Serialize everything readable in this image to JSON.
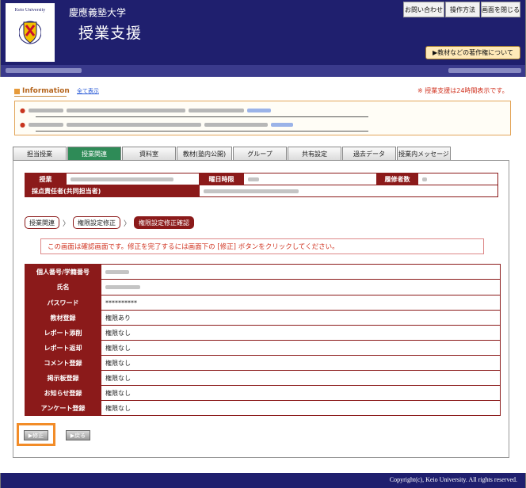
{
  "header": {
    "logo_text": "Keio University",
    "university_name": "慶應義塾大学",
    "site_title": "授業支援",
    "buttons": {
      "contact": "お問い合わせ",
      "manual": "操作方法",
      "close": "画面を閉じる"
    },
    "copyright_button": "▶教材などの著作権について"
  },
  "info": {
    "title": "Information",
    "show_all": "全て表示",
    "notice": "※ 授業支援は24時間表示です。"
  },
  "tabs": [
    {
      "label": "担当授業"
    },
    {
      "label": "授業関連"
    },
    {
      "label": "資料室"
    },
    {
      "label": "教材(塾内公開)"
    },
    {
      "label": "グループ"
    },
    {
      "label": "共有設定"
    },
    {
      "label": "過去データ"
    },
    {
      "label": "授業内メッセージ"
    }
  ],
  "course": {
    "label_course": "授業",
    "label_day": "曜日時限",
    "label_students": "履修者数",
    "label_grader": "採点責任者(共同担当者)"
  },
  "breadcrumb": {
    "items": [
      "授業関連",
      "権限設定修正",
      "権限設定修正確認"
    ]
  },
  "confirm_message": "この画面は確認画面です。修正を完了するには画面下の [修正] ボタンをクリックしてください。",
  "details": {
    "rows": [
      {
        "label": "個人番号/学籍番号",
        "value": ""
      },
      {
        "label": "氏名",
        "value": ""
      },
      {
        "label": "パスワード",
        "value": "**********"
      },
      {
        "label": "教材登録",
        "value": "権限あり"
      },
      {
        "label": "レポート添削",
        "value": "権限なし"
      },
      {
        "label": "レポート返却",
        "value": "権限なし"
      },
      {
        "label": "コメント登録",
        "value": "権限なし"
      },
      {
        "label": "掲示板登録",
        "value": "権限なし"
      },
      {
        "label": "お知らせ登録",
        "value": "権限なし"
      },
      {
        "label": "アンケート登録",
        "value": "権限なし"
      }
    ]
  },
  "actions": {
    "submit": "▶修正",
    "back": "▶戻る"
  },
  "footer": {
    "copyright": "Copyright(c), Keio University. All rights reserved."
  },
  "colors": {
    "header_bg": "#1f1f6e",
    "label_bg": "#8b1a1a",
    "active_tab": "#2e8b57",
    "highlight": "#f28c28",
    "notice_red": "#d0321f"
  }
}
